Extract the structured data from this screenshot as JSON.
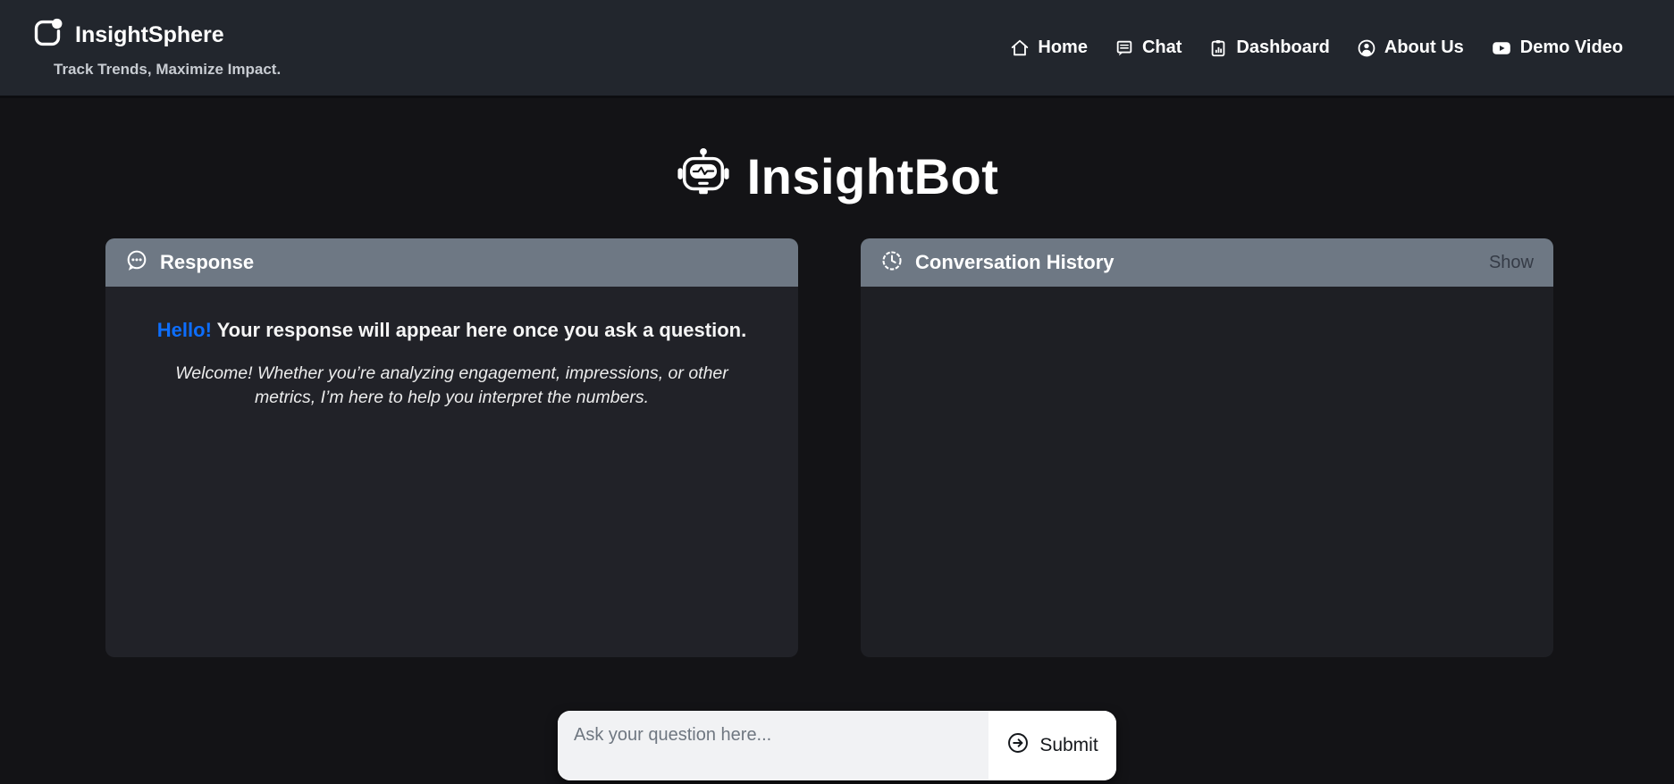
{
  "brand": {
    "name": "InsightSphere",
    "tagline": "Track Trends, Maximize Impact.",
    "logo_icon": "sphere-logo-icon"
  },
  "nav": {
    "items": [
      {
        "label": "Home",
        "icon": "home-icon"
      },
      {
        "label": "Chat",
        "icon": "chat-icon"
      },
      {
        "label": "Dashboard",
        "icon": "dashboard-icon"
      },
      {
        "label": "About Us",
        "icon": "user-circle-icon"
      },
      {
        "label": "Demo Video",
        "icon": "youtube-icon"
      }
    ]
  },
  "hero": {
    "title": "InsightBot",
    "icon": "robot-icon"
  },
  "response_panel": {
    "title": "Response",
    "icon": "comment-dots-icon",
    "greeting": "Hello!",
    "greeting_rest": "Your response will appear here once you ask a question.",
    "welcome": "Welcome! Whether you’re analyzing engagement, impressions, or other metrics, I’m here to help you interpret the numbers."
  },
  "history_panel": {
    "title": "Conversation History",
    "icon": "clock-history-icon",
    "toggle_label": "Show"
  },
  "composer": {
    "placeholder": "Ask your question here...",
    "input_value": "",
    "submit_label": "Submit",
    "submit_icon": "arrow-right-circle-icon"
  },
  "colors": {
    "accent_blue": "#0d6efd",
    "topbar_bg": "#22262d",
    "page_bg": "#131316",
    "panel_header_bg": "#6e7884",
    "response_body_bg": "#212228",
    "history_body_bg": "#1e1f24",
    "composer_input_bg": "#f1f2f4",
    "show_label_color": "#353b46"
  }
}
